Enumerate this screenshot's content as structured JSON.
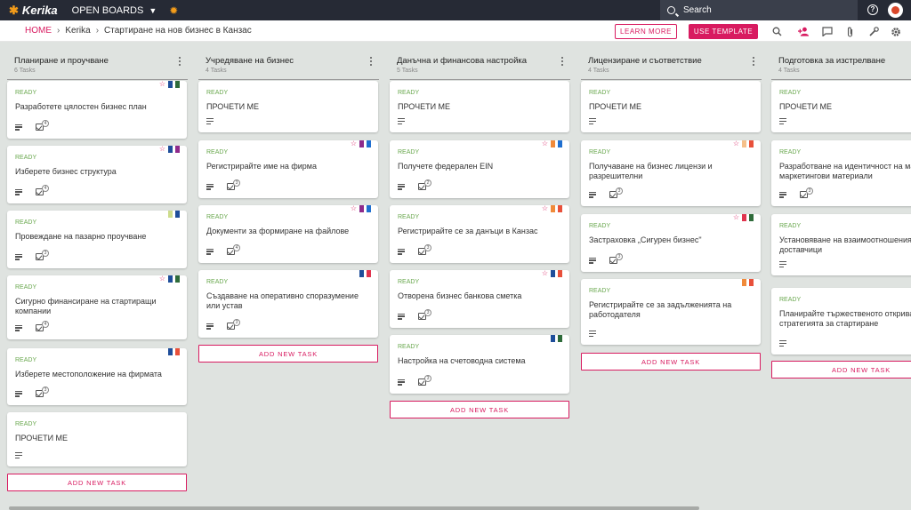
{
  "app": {
    "name": "Kerika",
    "open_boards_label": "OPEN BOARDS"
  },
  "search": {
    "placeholder": "Search"
  },
  "breadcrumb": {
    "home": "HOME",
    "account": "Kerika",
    "board": "Стартиране на нов бизнес в Канзас"
  },
  "toolbar": {
    "learn_more": "LEARN MORE",
    "use_template": "USE TEMPLATE"
  },
  "columns": [
    {
      "title": "Планиране и проучване",
      "count": "6 Tasks",
      "add_label": "ADD NEW TASK",
      "cards": [
        {
          "status": "READY",
          "title": "Разработете цялостен бизнес план",
          "checklist": "4",
          "star": true,
          "flags": [
            "#1f4e9a",
            "#2e6b3a"
          ]
        },
        {
          "status": "READY",
          "title": "Изберете бизнес структура",
          "checklist": "4",
          "star": true,
          "flags": [
            "#1f4e9a",
            "#8e2a8b"
          ]
        },
        {
          "status": "READY",
          "title": "Провеждане на пазарно проучване",
          "checklist": "3",
          "star": false,
          "flags": [
            "#cddc8c",
            "#1f4e9a"
          ]
        },
        {
          "status": "READY",
          "title": "Сигурно финансиране на стартиращи компании",
          "checklist": "4",
          "star": true,
          "flags": [
            "#1f4e9a",
            "#2e6b3a"
          ]
        },
        {
          "status": "READY",
          "title": "Изберете местоположение на фирмата",
          "checklist": "3",
          "star": false,
          "flags": [
            "#1f4e9a",
            "#e8503a"
          ]
        },
        {
          "status": "READY",
          "title": "ПРОЧЕТИ МЕ",
          "checklist": null,
          "star": false,
          "flags": []
        }
      ]
    },
    {
      "title": "Учредяване на бизнес",
      "count": "4 Tasks",
      "add_label": "ADD NEW TASK",
      "cards": [
        {
          "status": "READY",
          "title": "ПРОЧЕТИ МЕ",
          "checklist": null,
          "star": false,
          "flags": []
        },
        {
          "status": "READY",
          "title": "Регистрирайте име на фирма",
          "checklist": "3",
          "star": true,
          "flags": [
            "#8e2a8b",
            "#1f6fd0"
          ]
        },
        {
          "status": "READY",
          "title": "Документи за формиране на файлове",
          "checklist": "4",
          "star": true,
          "flags": [
            "#8e2a8b",
            "#1f6fd0"
          ]
        },
        {
          "status": "READY",
          "title": "Създаване на оперативно споразумение или устав",
          "checklist": "3",
          "star": false,
          "flags": [
            "#1f4e9a",
            "#e0344e"
          ]
        }
      ]
    },
    {
      "title": "Данъчна и финансова настройка",
      "count": "5 Tasks",
      "add_label": "ADD NEW TASK",
      "cards": [
        {
          "status": "READY",
          "title": "ПРОЧЕТИ МЕ",
          "checklist": null,
          "star": false,
          "flags": []
        },
        {
          "status": "READY",
          "title": "Получете федерален EIN",
          "checklist": "2",
          "star": true,
          "flags": [
            "#f08a3a",
            "#1f6fd0"
          ]
        },
        {
          "status": "READY",
          "title": "Регистрирайте се за данъци в Канзас",
          "checklist": "3",
          "star": true,
          "flags": [
            "#f08a3a",
            "#e8503a"
          ]
        },
        {
          "status": "READY",
          "title": "Отворена бизнес банкова сметка",
          "checklist": "3",
          "star": true,
          "flags": [
            "#1f4e9a",
            "#e8503a"
          ]
        },
        {
          "status": "READY",
          "title": "Настройка на счетоводна система",
          "checklist": "3",
          "star": false,
          "flags": [
            "#1f4e9a",
            "#2e6b3a"
          ]
        }
      ]
    },
    {
      "title": "Лицензиране и съответствие",
      "count": "4 Tasks",
      "add_label": "ADD NEW TASK",
      "cards": [
        {
          "status": "READY",
          "title": "ПРОЧЕТИ МЕ",
          "checklist": null,
          "star": false,
          "flags": []
        },
        {
          "status": "READY",
          "title": "Получаване на бизнес лицензи и разрешителни",
          "checklist": "3",
          "star": true,
          "flags": [
            "#f5c08a",
            "#e8503a"
          ]
        },
        {
          "status": "READY",
          "title": "Застраховка „Сигурен бизнес\"",
          "checklist": "3",
          "star": true,
          "flags": [
            "#e0344e",
            "#2e6b3a"
          ]
        },
        {
          "status": "READY",
          "title": "Регистрирайте се за задълженията на работодателя",
          "checklist": null,
          "star": false,
          "flags": [
            "#f08a3a",
            "#e8503a"
          ]
        }
      ]
    },
    {
      "title": "Подготовка за изстрелване",
      "count": "4 Tasks",
      "add_label": "ADD NEW TASK",
      "cards": [
        {
          "status": "READY",
          "title": "ПРОЧЕТИ МЕ",
          "checklist": null,
          "star": false,
          "flags": []
        },
        {
          "status": "READY",
          "title": "Разработване на идентичност на марката и маркетингови материали",
          "checklist": "3",
          "star": false,
          "flags": []
        },
        {
          "status": "READY",
          "title": "Установяване на взаимоотношения с доставчици",
          "checklist": null,
          "star": false,
          "flags": []
        },
        {
          "status": "READY",
          "title": "Планирайте тържественото откриване и стратегията за стартиране",
          "checklist": null,
          "star": false,
          "flags": []
        }
      ]
    }
  ],
  "colors": {
    "accent": "#d81b60",
    "ready": "#6aa84f",
    "topbar": "#262a35",
    "board_bg": "#dfe3e0"
  }
}
